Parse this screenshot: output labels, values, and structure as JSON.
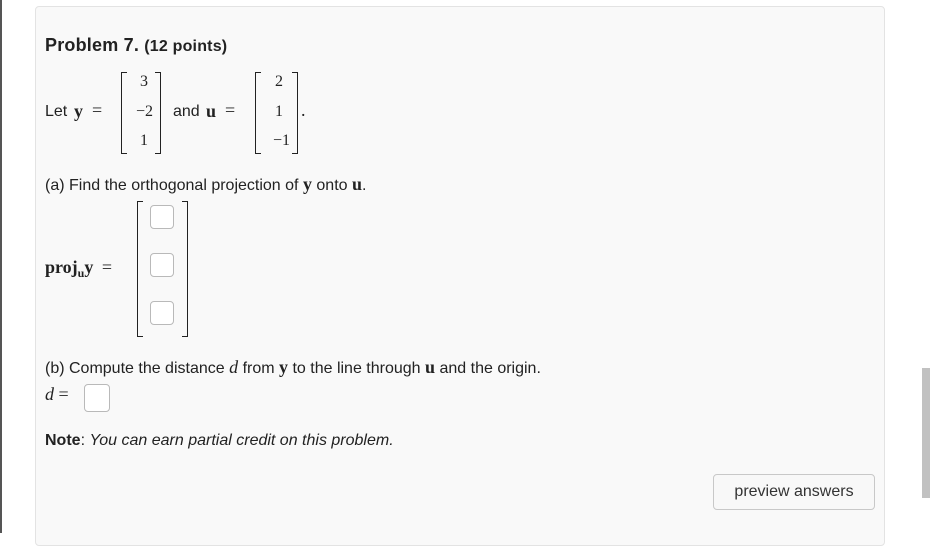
{
  "problem": {
    "title": "Problem 7.",
    "points": "(12 points)"
  },
  "statement": {
    "let": "Let",
    "y_symbol": "y",
    "equals": "=",
    "y_vector": [
      "3",
      "−2",
      "1"
    ],
    "and": "and",
    "u_symbol": "u",
    "u_vector": [
      "2",
      "1",
      "−1"
    ],
    "period": "."
  },
  "part_a": {
    "prefix": "(a) Find the orthogonal projection of",
    "y": "y",
    "onto": "onto",
    "u": "u",
    "period": ".",
    "proj_label": "proj",
    "proj_sub": "u",
    "proj_y": "y",
    "equals": "="
  },
  "part_b": {
    "prefix": "(b) Compute the distance",
    "d": "d",
    "from": "from",
    "y": "y",
    "to_line": "to the line through",
    "u": "u",
    "suffix": "and the origin.",
    "answer_label": "d",
    "equals": "="
  },
  "note": {
    "label": "Note",
    "colon": ":",
    "text": "You can earn partial credit on this problem."
  },
  "preview_button": "preview answers"
}
